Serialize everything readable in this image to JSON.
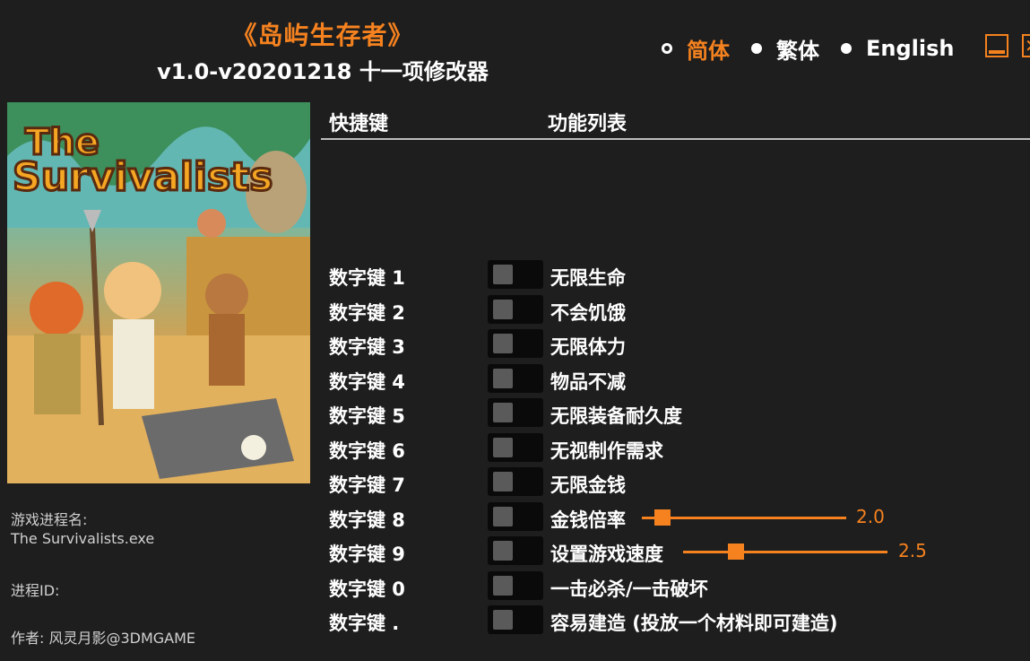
{
  "header": {
    "title": "《岛屿生存者》",
    "subtitle": "v1.0-v20201218 十一项修改器"
  },
  "languages": [
    {
      "label": "简体",
      "selected": true
    },
    {
      "label": "繁体",
      "selected": false
    },
    {
      "label": "English",
      "selected": false
    }
  ],
  "colors": {
    "accent": "#f5821f",
    "background": "#1e1e1e"
  },
  "cover": {
    "logo_line1": "The",
    "logo_line2": "Survivalists"
  },
  "info": {
    "process_label": "游戏进程名:",
    "process_value": "The Survivalists.exe",
    "pid_label": "进程ID:",
    "author": "作者: 风灵月影@3DMGAME"
  },
  "table": {
    "col_hotkey": "快捷键",
    "col_function": "功能列表"
  },
  "cheats": [
    {
      "hotkey": "数字键 1",
      "name": "无限生命"
    },
    {
      "hotkey": "数字键 2",
      "name": "不会饥饿"
    },
    {
      "hotkey": "数字键 3",
      "name": "无限体力"
    },
    {
      "hotkey": "数字键 4",
      "name": "物品不减"
    },
    {
      "hotkey": "数字键 5",
      "name": "无限装备耐久度"
    },
    {
      "hotkey": "数字键 6",
      "name": "无视制作需求"
    },
    {
      "hotkey": "数字键 7",
      "name": "无限金钱"
    },
    {
      "hotkey": "数字键 8",
      "name": "金钱倍率",
      "slider_value": "2.0",
      "slider_fraction": 0.1
    },
    {
      "hotkey": "数字键 9",
      "name": "设置游戏速度",
      "slider_value": "2.5",
      "slider_fraction": 0.26
    },
    {
      "hotkey": "数字键 0",
      "name": "一击必杀/一击破坏"
    },
    {
      "hotkey": "数字键 .",
      "name": "容易建造 (投放一个材料即可建造)"
    }
  ]
}
